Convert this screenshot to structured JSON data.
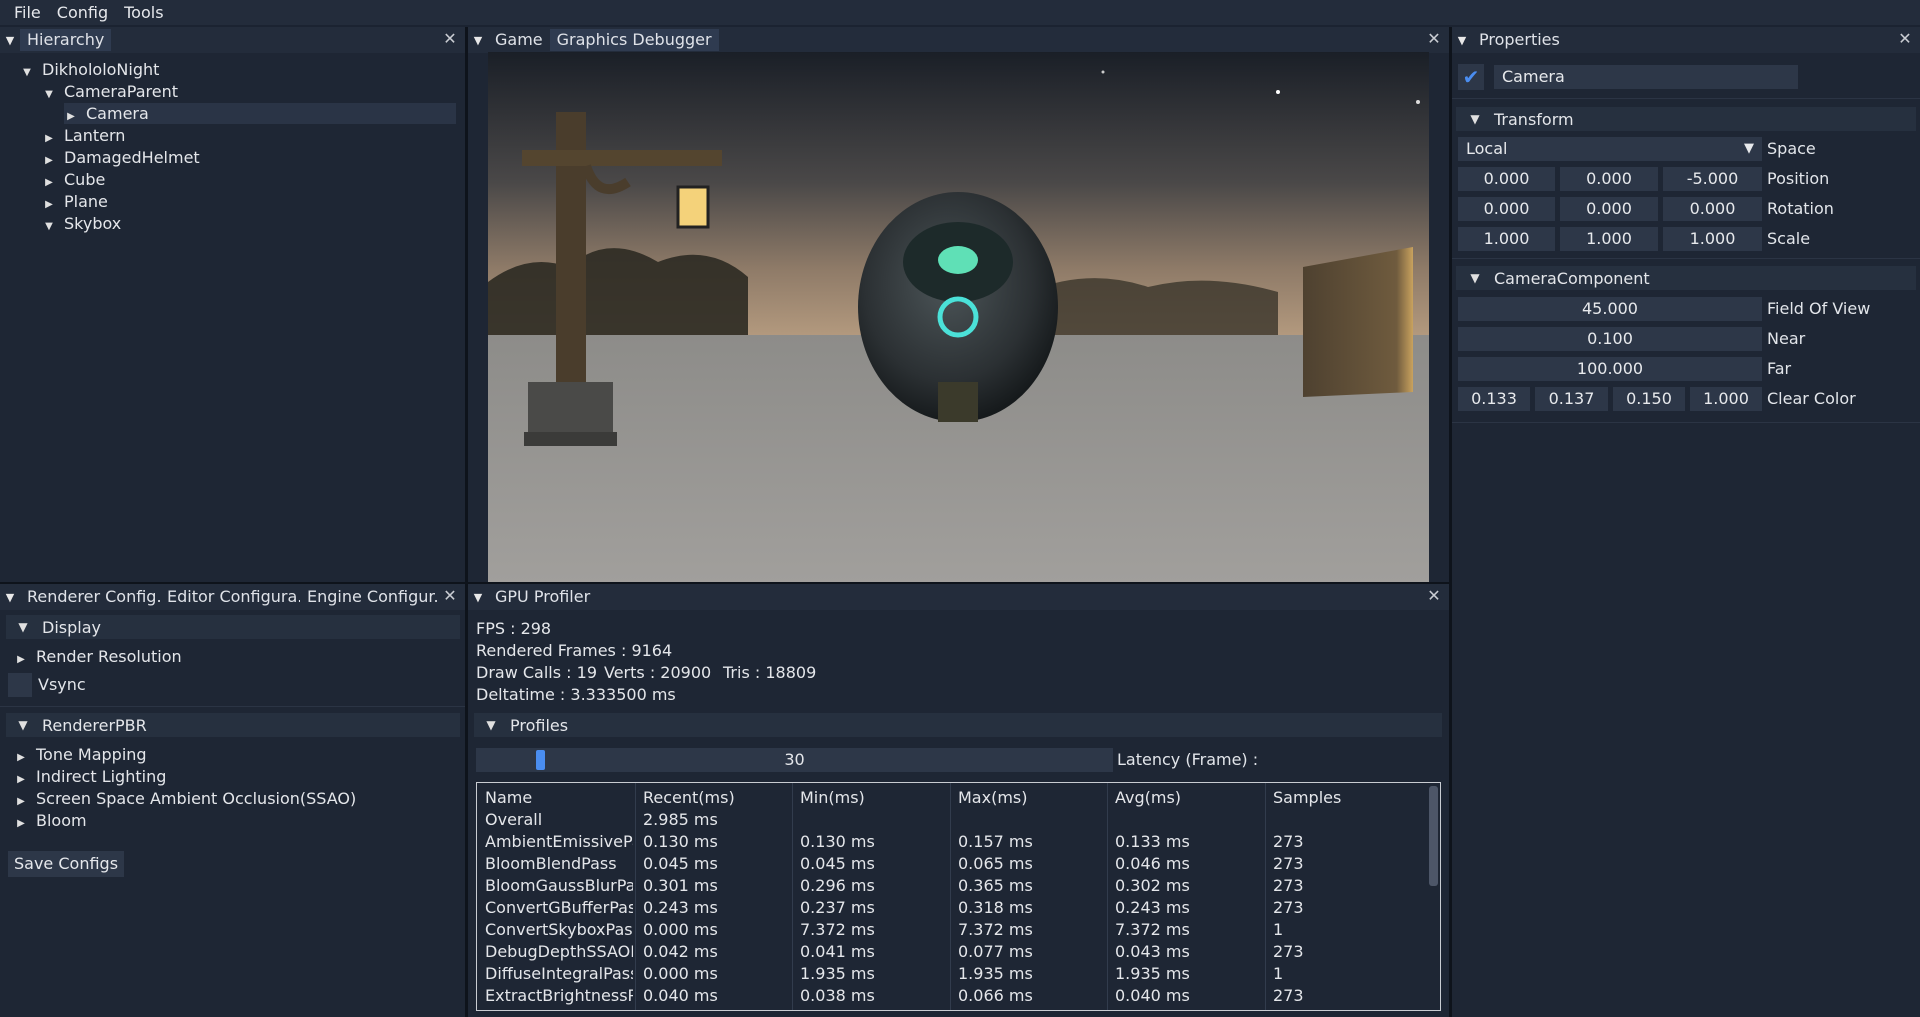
{
  "menu": [
    "File",
    "Config",
    "Tools"
  ],
  "hierarchy": {
    "tab": "Hierarchy",
    "items": [
      {
        "label": "DikhololoNight",
        "level": 0,
        "expanded": true
      },
      {
        "label": "CameraParent",
        "level": 1,
        "expanded": true
      },
      {
        "label": "Camera",
        "level": 2,
        "expanded": false,
        "selected": true
      },
      {
        "label": "Lantern",
        "level": 1,
        "expanded": false
      },
      {
        "label": "DamagedHelmet",
        "level": 1,
        "expanded": false
      },
      {
        "label": "Cube",
        "level": 1,
        "expanded": false
      },
      {
        "label": "Plane",
        "level": 1,
        "expanded": false
      },
      {
        "label": "Skybox",
        "level": 1,
        "expanded": true
      }
    ]
  },
  "viewport_tabs": [
    "Game",
    "Graphics Debugger"
  ],
  "properties": {
    "tab": "Properties",
    "object_name": "Camera",
    "enabled": true,
    "transform": {
      "title": "Transform",
      "space_value": "Local",
      "space_label": "Space",
      "position": {
        "label": "Position",
        "values": [
          "0.000",
          "0.000",
          "-5.000"
        ]
      },
      "rotation": {
        "label": "Rotation",
        "values": [
          "0.000",
          "0.000",
          "0.000"
        ]
      },
      "scale": {
        "label": "Scale",
        "values": [
          "1.000",
          "1.000",
          "1.000"
        ]
      }
    },
    "camera": {
      "title": "CameraComponent",
      "fov": {
        "label": "Field Of View",
        "value": "45.000"
      },
      "near": {
        "label": "Near",
        "value": "0.100"
      },
      "far": {
        "label": "Far",
        "value": "100.000"
      },
      "clear_color": {
        "label": "Clear Color",
        "values": [
          "0.133",
          "0.137",
          "0.150",
          "1.000"
        ]
      }
    }
  },
  "config": {
    "tabs": [
      "Renderer Config...",
      "Editor Configura...",
      "Engine Configur..."
    ],
    "display_title": "Display",
    "render_resolution": "Render Resolution",
    "vsync": "Vsync",
    "renderer_title": "RendererPBR",
    "renderer_items": [
      "Tone Mapping",
      "Indirect Lighting",
      "Screen Space Ambient Occlusion(SSAO)",
      "Bloom"
    ],
    "save_button": "Save Configs"
  },
  "profiler": {
    "tab": "GPU Profiler",
    "fps": "FPS : 298",
    "rendered_frames": "Rendered Frames : 9164",
    "draw_calls": "Draw Calls : 19",
    "verts": "Verts : 20900",
    "tris": "Tris : 18809",
    "deltatime": "Deltatime : 3.333500 ms",
    "profiles_title": "Profiles",
    "latency_value": "30",
    "latency_fraction": 0.1,
    "latency_label": "Latency (Frame) :",
    "columns": [
      "Name",
      "Recent(ms)",
      "Min(ms)",
      "Max(ms)",
      "Avg(ms)",
      "Samples"
    ],
    "rows": [
      [
        "Overall",
        "2.985 ms",
        "",
        "",
        "",
        ""
      ],
      [
        "AmbientEmissivePass",
        "0.130 ms",
        "0.130 ms",
        "0.157 ms",
        "0.133 ms",
        "273"
      ],
      [
        "BloomBlendPass",
        "0.045 ms",
        "0.045 ms",
        "0.065 ms",
        "0.046 ms",
        "273"
      ],
      [
        "BloomGaussBlurPass",
        "0.301 ms",
        "0.296 ms",
        "0.365 ms",
        "0.302 ms",
        "273"
      ],
      [
        "ConvertGBufferPass",
        "0.243 ms",
        "0.237 ms",
        "0.318 ms",
        "0.243 ms",
        "273"
      ],
      [
        "ConvertSkyboxPass",
        "0.000 ms",
        "7.372 ms",
        "7.372 ms",
        "7.372 ms",
        "1"
      ],
      [
        "DebugDepthSSAOPass",
        "0.042 ms",
        "0.041 ms",
        "0.077 ms",
        "0.043 ms",
        "273"
      ],
      [
        "DiffuseIntegralPass",
        "0.000 ms",
        "1.935 ms",
        "1.935 ms",
        "1.935 ms",
        "1"
      ],
      [
        "ExtractBrightnessPass",
        "0.040 ms",
        "0.038 ms",
        "0.066 ms",
        "0.040 ms",
        "273"
      ]
    ]
  },
  "colors": {
    "accent": "#4a8df0",
    "panel": "#1e2634",
    "tabbar": "#232c3b"
  }
}
